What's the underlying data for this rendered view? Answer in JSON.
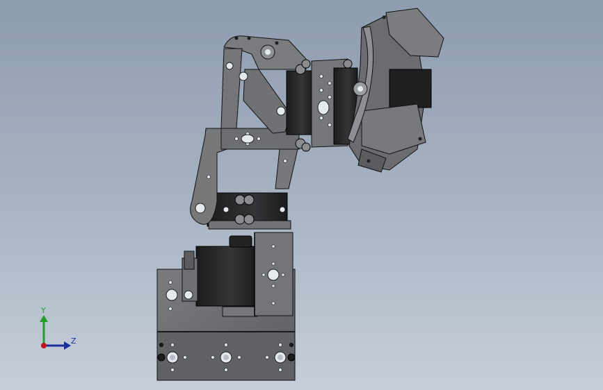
{
  "viewport": {
    "background_top": "#8d9cae",
    "background_bottom": "#c6ced9",
    "model_fill": "#6f7174",
    "model_dark": "#2b2b2d",
    "model_edge": "#111111"
  },
  "triad": {
    "y_label": "Y",
    "z_label": "Z",
    "y_color": "#1fa02a",
    "z_color": "#1b2f9c",
    "x_color": "#c0141a"
  }
}
